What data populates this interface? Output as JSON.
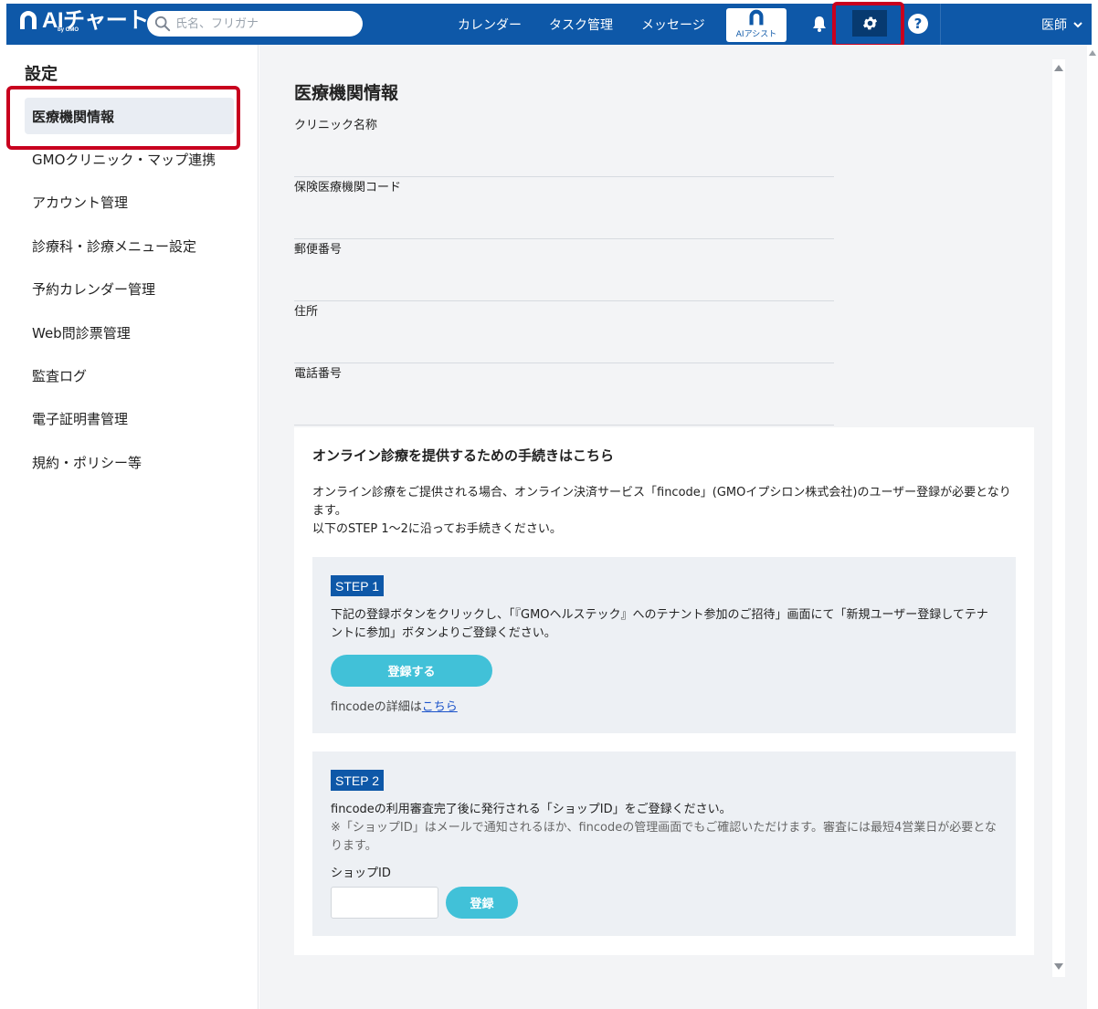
{
  "header": {
    "logo_text": "AIチャート",
    "logo_sub": "by GMO",
    "search_placeholder": "氏名、フリガナ",
    "nav": [
      {
        "label": "カレンダー"
      },
      {
        "label": "タスク管理"
      },
      {
        "label": "メッセージ"
      }
    ],
    "ai_assist_label": "AIアシスト",
    "help_glyph": "?",
    "user_label": "医師"
  },
  "sidebar": {
    "title": "設定",
    "items": [
      {
        "label": "医療機関情報",
        "active": true
      },
      {
        "label": "GMOクリニック・マップ連携"
      },
      {
        "label": "アカウント管理"
      },
      {
        "label": "診療科・診療メニュー設定"
      },
      {
        "label": "予約カレンダー管理"
      },
      {
        "label": "Web問診票管理"
      },
      {
        "label": "監査ログ"
      },
      {
        "label": "電子証明書管理"
      },
      {
        "label": "規約・ポリシー等"
      }
    ]
  },
  "main": {
    "title": "医療機関情報",
    "fields": [
      {
        "label": "クリニック名称"
      },
      {
        "label": "保険医療機関コード"
      },
      {
        "label": "郵便番号"
      },
      {
        "label": "住所"
      },
      {
        "label": "電話番号"
      }
    ],
    "online": {
      "title": "オンライン診療を提供するための手続きはこちら",
      "desc_line1": "オンライン診療をご提供される場合、オンライン決済サービス「fincode」(GMOイプシロン株式会社)のユーザー登録が必要となります。",
      "desc_line2": "以下のSTEP 1〜2に沿ってお手続きください。",
      "step1": {
        "badge": "STEP 1",
        "text": "下記の登録ボタンをクリックし、「『GMOヘルステック』へのテナント参加のご招待」画面にて「新規ユーザー登録してテナントに参加」ボタンよりご登録ください。",
        "button": "登録する",
        "detail_prefix": "fincodeの詳細は",
        "detail_link": "こちら"
      },
      "step2": {
        "badge": "STEP 2",
        "text": "fincodeの利用審査完了後に発行される「ショップID」をご登録ください。",
        "note": "※「ショップID」はメールで通知されるほか、fincodeの管理画面でもご確認いただけます。審査には最短4営業日が必要となります。",
        "shop_label": "ショップID",
        "shop_value": "",
        "button": "登録"
      }
    }
  },
  "colors": {
    "header_bg": "#0e58a8",
    "accent_button": "#41c1d8",
    "highlight": "#c8001e"
  }
}
